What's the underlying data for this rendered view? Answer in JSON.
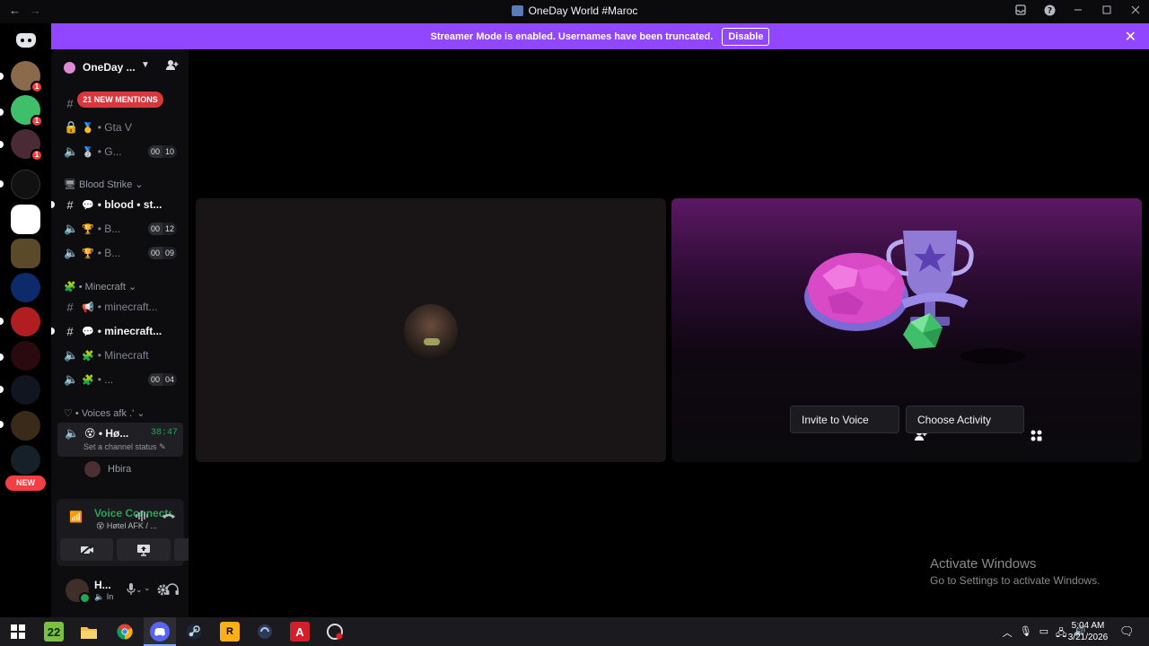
{
  "titlebar": {
    "back_icon": "←",
    "forward_icon": "→",
    "title": "OneDay World #Maroc"
  },
  "banner": {
    "message": "Streamer Mode is enabled. Usernames have been truncated.",
    "disable_label": "Disable",
    "close_icon": "✕",
    "color": "#9146ff"
  },
  "rail": {
    "new_label": "NEW",
    "badges": [
      "1",
      "1",
      "1"
    ]
  },
  "guild": {
    "name": "OneDay ...",
    "mentions_label": "21 NEW MENTIONS"
  },
  "channels": {
    "gta": {
      "name": "Gta V",
      "emoji": "🥇"
    },
    "g": {
      "name": "G...",
      "emoji": "🥈",
      "count_a": "00",
      "count_b": "10"
    },
    "cat_blood": "Blood Strike",
    "blood_chat": {
      "name": "blood • st..."
    },
    "b1": {
      "name": "B...",
      "emoji": "🏆",
      "count_a": "00",
      "count_b": "12"
    },
    "b2": {
      "name": "B...",
      "emoji": "🏆",
      "count_a": "00",
      "count_b": "09"
    },
    "cat_minecraft": "Minecraft",
    "mc1": {
      "name": "minecraft..."
    },
    "mc2": {
      "name": "minecraft..."
    },
    "mc3": {
      "name": "Minecraft"
    },
    "mc4": {
      "name": "...",
      "count_a": "00",
      "count_b": "04"
    },
    "cat_voices": "Voices afk .'",
    "active": {
      "name": "Hø...",
      "time": "38:47",
      "status": "Set a channel status"
    },
    "member": "Hbira"
  },
  "voice_panel": {
    "title": "Voice Connected",
    "subtitle": "Høtel AFK / ..."
  },
  "user_panel": {
    "name": "H...",
    "status": "In"
  },
  "stage": {
    "invite_label": "Invite to Voice",
    "activity_label": "Choose Activity"
  },
  "watermark": {
    "line1": "Activate Windows",
    "line2": "Go to Settings to activate Windows."
  },
  "taskbar": {
    "time": "5:04 AM",
    "date": "3/21/2026",
    "weather": "22"
  }
}
